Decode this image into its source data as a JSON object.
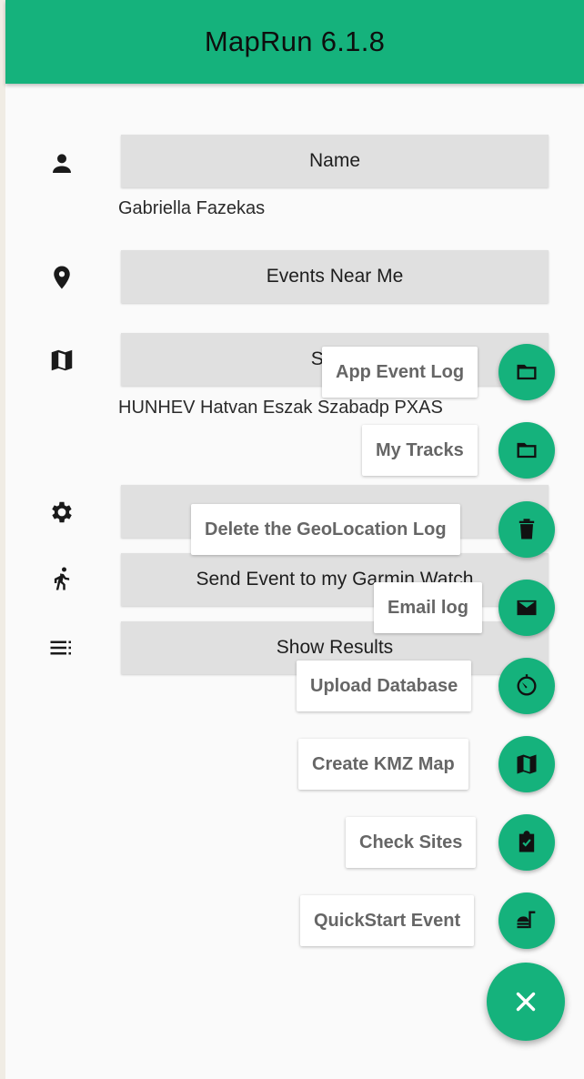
{
  "appbar": {
    "title": "MapRun 6.1.8"
  },
  "rows": {
    "name": {
      "button": "Name",
      "value": "Gabriella Fazekas",
      "icon": "person-icon"
    },
    "events_near_me": {
      "button": "Events Near Me",
      "icon": "location-pin-icon"
    },
    "select_event": {
      "button": "Selec",
      "value": "HUNHEV Hatvan Eszak Szabadp PXAS",
      "icon": "map-icon"
    },
    "settings": {
      "button": "",
      "icon": "gear-icon"
    },
    "garmin": {
      "button": "Send Event to my Garmin Watch",
      "icon": "runner-icon"
    },
    "results": {
      "button": "Show Results",
      "icon": "list-icon"
    }
  },
  "speed_dial": {
    "items": [
      {
        "label": "App Event Log",
        "icon": "folder-icon"
      },
      {
        "label": "My Tracks",
        "icon": "folder-icon"
      },
      {
        "label": "Delete the GeoLocation Log",
        "icon": "trash-icon"
      },
      {
        "label": "Email log",
        "icon": "mail-icon"
      },
      {
        "label": "Upload Database",
        "icon": "timer-icon"
      },
      {
        "label": "Create KMZ Map",
        "icon": "map-icon"
      },
      {
        "label": "Check Sites",
        "icon": "clipboard-check-icon"
      },
      {
        "label": "QuickStart Event",
        "icon": "quickstart-icon"
      }
    ],
    "close_icon": "close-icon"
  },
  "colors": {
    "accent": "#15b27c",
    "button_bg": "#e0e0e0",
    "label_text": "#666666"
  }
}
